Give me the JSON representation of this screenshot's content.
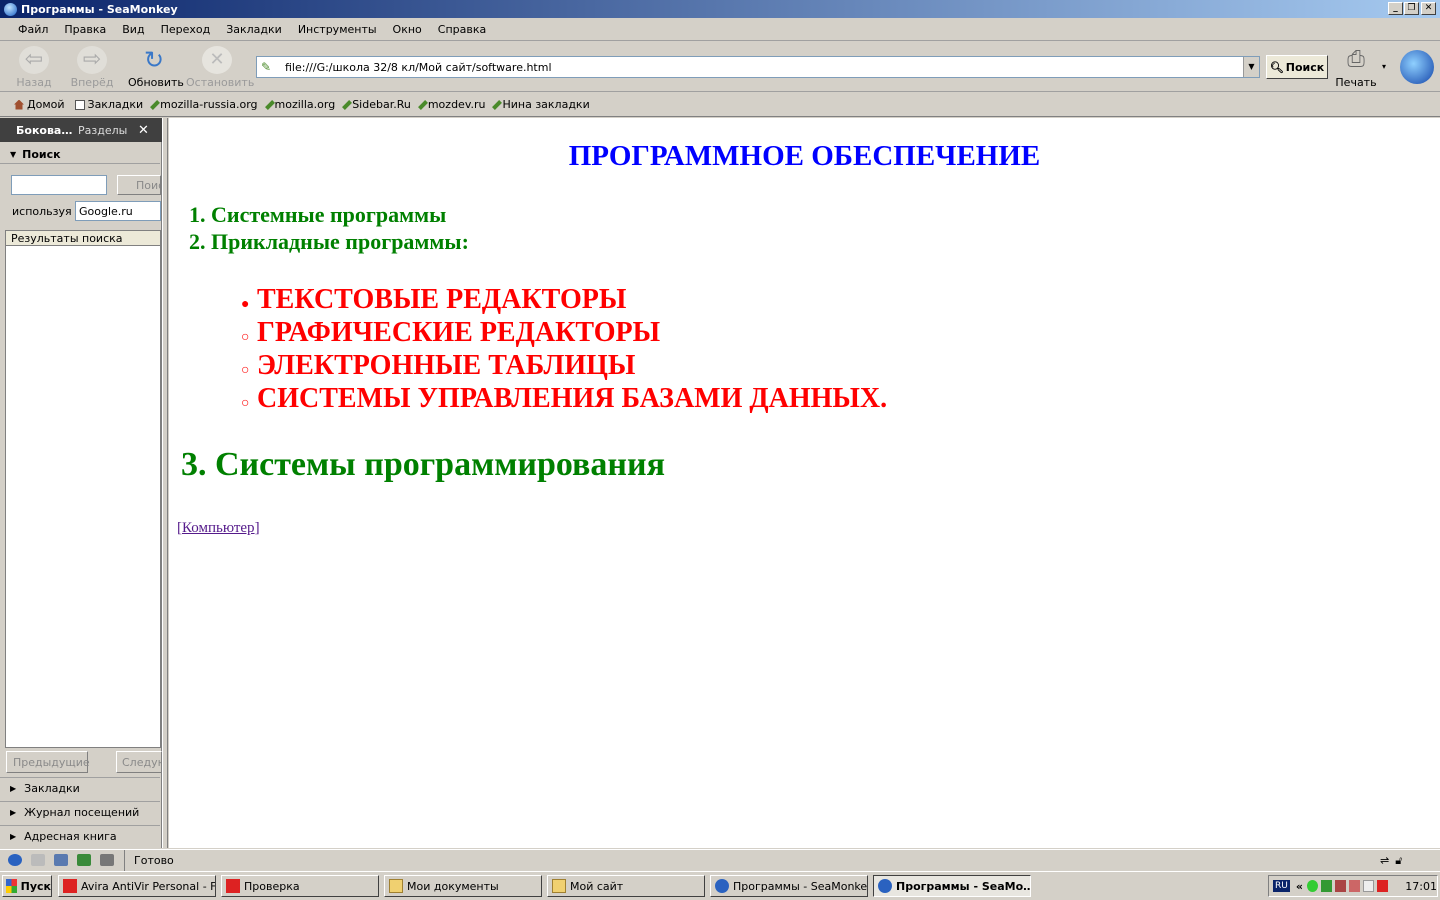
{
  "window": {
    "title": "Программы - SeaMonkey"
  },
  "menu": [
    "Файл",
    "Правка",
    "Вид",
    "Переход",
    "Закладки",
    "Инструменты",
    "Окно",
    "Справка"
  ],
  "nav": {
    "back": "Назад",
    "forward": "Вперёд",
    "reload": "Обновить",
    "stop": "Остановить",
    "url": "file:///G:/школа 32/8 кл/Мой сайт/software.html",
    "search": "Поиск",
    "print": "Печать"
  },
  "bookmarks": [
    "Домой",
    "Закладки",
    "mozilla-russia.org",
    "mozilla.org",
    "Sidebar.Ru",
    "mozdev.ru",
    "Нина закладки"
  ],
  "sidebar": {
    "tab_active": "Бокова…",
    "tab_sections": "Разделы",
    "search_header": "Поиск",
    "search_button": "Поис",
    "using_label": "используя",
    "engine": "Google.ru",
    "results_header": "Результаты поиска",
    "prev": "Предыдущие",
    "next": "Следую",
    "sections": [
      "Закладки",
      "Журнал посещений",
      "Адресная книга"
    ]
  },
  "page": {
    "title": "ПРОГРАММНОЕ ОБЕСПЕЧЕНИЕ",
    "items": [
      "1. Системные программы",
      "2. Прикладные программы:"
    ],
    "subitems": [
      "ТЕКСТОВЫЕ РЕДАКТОРЫ",
      "ГРАФИЧЕСКИЕ РЕДАКТОРЫ",
      "ЭЛЕКТРОННЫЕ ТАБЛИЦЫ",
      "СИСТЕМЫ УПРАВЛЕНИЯ БАЗАМИ ДАННЫХ."
    ],
    "item3": "3. Системы программирования",
    "link": "Компьютер"
  },
  "status": {
    "text": "Готово"
  },
  "taskbar": {
    "start": "Пуск",
    "tasks": [
      "Avira AntiVir Personal - F…",
      "Проверка",
      "Мои документы",
      "Мой сайт",
      "Программы - SeaMonkey",
      "Программы - SeaMo…"
    ],
    "lang": "RU",
    "clock": "17:01"
  }
}
